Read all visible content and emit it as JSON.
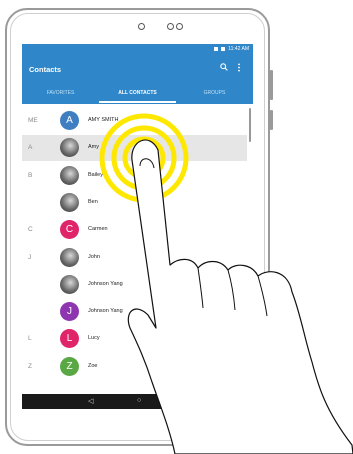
{
  "statusbar": {
    "time": "11:42 AM"
  },
  "appbar": {
    "title": "Contacts",
    "search_icon": "search-icon",
    "menu_icon": "more-vert-icon"
  },
  "tabs": [
    {
      "label": "FAVORITES",
      "active": false
    },
    {
      "label": "ALL CONTACTS",
      "active": true
    },
    {
      "label": "GROUPS",
      "active": false
    }
  ],
  "contacts": [
    {
      "section": "ME",
      "name": "AMY SMITH",
      "avatar_letter": "A",
      "avatar_color": "#3f7fc1",
      "avatar_type": "letter",
      "selected": false
    },
    {
      "section": "A",
      "name": "Amy",
      "avatar_letter": "",
      "avatar_color": "",
      "avatar_type": "photo",
      "selected": true
    },
    {
      "section": "B",
      "name": "Bailey",
      "avatar_letter": "",
      "avatar_color": "",
      "avatar_type": "photo",
      "selected": false
    },
    {
      "section": "",
      "name": "Ben",
      "avatar_letter": "",
      "avatar_color": "",
      "avatar_type": "photo",
      "selected": false
    },
    {
      "section": "C",
      "name": "Carmen",
      "avatar_letter": "C",
      "avatar_color": "#e0246a",
      "avatar_type": "letter",
      "selected": false
    },
    {
      "section": "J",
      "name": "John",
      "avatar_letter": "",
      "avatar_color": "",
      "avatar_type": "photo",
      "selected": false
    },
    {
      "section": "",
      "name": "Johnson Yang",
      "avatar_letter": "",
      "avatar_color": "",
      "avatar_type": "photo",
      "selected": false
    },
    {
      "section": "",
      "name": "Johnson Yang",
      "avatar_letter": "J",
      "avatar_color": "#8e35b0",
      "avatar_type": "letter",
      "selected": false
    },
    {
      "section": "L",
      "name": "Lucy",
      "avatar_letter": "L",
      "avatar_color": "#e0246a",
      "avatar_type": "letter",
      "selected": false
    },
    {
      "section": "Z",
      "name": "Zoe",
      "avatar_letter": "Z",
      "avatar_color": "#5aa845",
      "avatar_type": "letter",
      "selected": false
    }
  ],
  "navbar": {
    "back": "◁",
    "home": "○"
  },
  "gesture": {
    "type": "touch-and-hold",
    "ring_color": "#ffe800"
  }
}
